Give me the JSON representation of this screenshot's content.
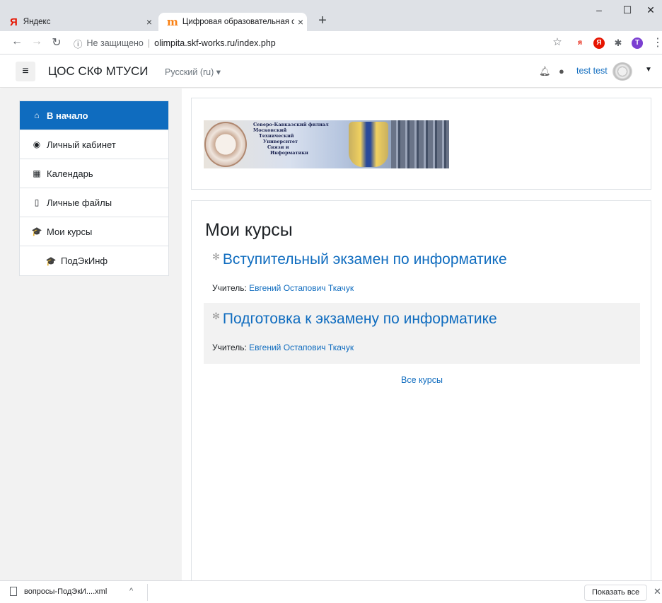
{
  "browser": {
    "tabs": [
      {
        "title": "Яндекс",
        "logo": "Я"
      },
      {
        "title": "Цифровая образовательная сре",
        "logo": "m"
      }
    ],
    "new_tab": "+",
    "window_controls": {
      "minimize": "–",
      "maximize": "☐",
      "close": "✕"
    },
    "security_label": "Не защищено",
    "url": "olimpita.skf-works.ru/index.php",
    "extensions": [
      {
        "name": "yandex-ext",
        "glyph": "я",
        "color": "#e61400"
      },
      {
        "name": "yandex-browser-ext",
        "glyph": "Я",
        "color": "#e61400"
      },
      {
        "name": "puzzle",
        "glyph": "✱",
        "color": "#5f6368"
      },
      {
        "name": "profile",
        "glyph": "T",
        "color": "#7b3fd1"
      }
    ]
  },
  "navbar": {
    "site_name": "ЦОС СКФ МТУСИ",
    "language": "Русский (ru) ▾",
    "user_name": "test test"
  },
  "drawer": {
    "items": [
      {
        "label": "В начало",
        "icon": "home-icon",
        "glyph": "⌂",
        "active": true
      },
      {
        "label": "Личный кабинет",
        "icon": "dashboard-icon",
        "glyph": "◉"
      },
      {
        "label": "Календарь",
        "icon": "calendar-icon",
        "glyph": "▦"
      },
      {
        "label": "Личные файлы",
        "icon": "file-icon",
        "glyph": "▯"
      },
      {
        "label": "Мои курсы",
        "icon": "graduation-cap-icon",
        "glyph": "🎓"
      },
      {
        "label": "ПодЭкИнф",
        "icon": "graduation-cap-icon",
        "glyph": "🎓",
        "sub": true
      }
    ]
  },
  "banner": {
    "lines": [
      "Северо-Кавказский филиал",
      "Московский",
      "Технический",
      "Университет",
      "Связи и",
      "Информатики"
    ]
  },
  "main": {
    "heading": "Мои курсы",
    "courses": [
      {
        "title": "Вступительный экзамен по информатике",
        "teacher_label": "Учитель:",
        "teacher": "Евгений Остапович Ткачук"
      },
      {
        "title": "Подготовка к экзамену по информатике",
        "teacher_label": "Учитель:",
        "teacher": "Евгений Остапович Ткачук"
      }
    ],
    "all_courses": "Все курсы"
  },
  "downloads": {
    "file": "вопросы-ПодЭкИ....xml",
    "show_all": "Показать все"
  }
}
